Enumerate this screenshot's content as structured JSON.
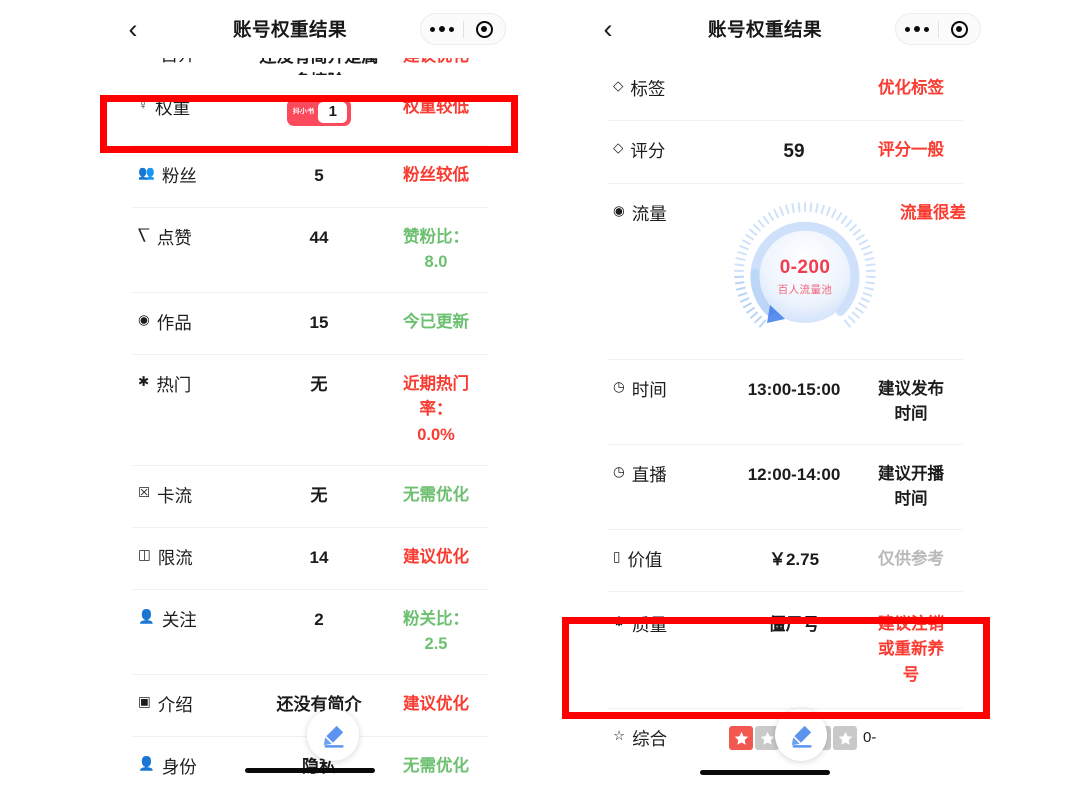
{
  "nav": {
    "back_icon": "chevron-left-icon",
    "title": "账号权重结果",
    "more_icon": "more-dots-icon",
    "target_icon": "target-circle-icon"
  },
  "left_panel": {
    "clipped_row": {
      "label": "一 自介",
      "value": "还没有简介是属多擦除",
      "status": "建议优化"
    },
    "rows": [
      {
        "icon": "location-pin-icon",
        "label": "权重",
        "value_type": "badge",
        "badge_text": "抖小书",
        "badge_number": "1",
        "status": "权重较低",
        "status_color": "red",
        "highlighted": true
      },
      {
        "icon": "people-icon",
        "label": "粉丝",
        "value": "5",
        "status": "粉丝较低",
        "status_color": "red"
      },
      {
        "icon": "thumb-icon",
        "label": "点赞",
        "value": "44",
        "status": "赞粉比：\n8.0",
        "status_color": "green"
      },
      {
        "icon": "circle-dot-icon",
        "label": "作品",
        "value": "15",
        "status": "今已更新",
        "status_color": "green"
      },
      {
        "icon": "star-small-icon",
        "label": "热门",
        "value": "无",
        "status": "近期热门\n率：\n0.0%",
        "status_color": "red"
      },
      {
        "icon": "card-slash-icon",
        "label": "卡流",
        "value": "无",
        "status": "无需优化",
        "status_color": "green"
      },
      {
        "icon": "doc-icon",
        "label": "限流",
        "value": "14",
        "status": "建议优化",
        "status_color": "red"
      },
      {
        "icon": "person-add-icon",
        "label": "关注",
        "value": "2",
        "status": "粉关比：\n2.5",
        "status_color": "green"
      },
      {
        "icon": "note-icon",
        "label": "介绍",
        "value": "还没有简介",
        "status": "建议优化",
        "status_color": "red"
      },
      {
        "icon": "person-icon",
        "label": "身份",
        "value": "隐私",
        "value_color": "pink",
        "status": "无需优化",
        "status_color": "green"
      }
    ],
    "fab_icon": "edit-pencil-icon",
    "home_indicator": true
  },
  "right_panel": {
    "rows": [
      {
        "icon": "tag-icon",
        "label": "标签",
        "value": "",
        "status": "优化标签",
        "status_color": "red"
      },
      {
        "icon": "tag-icon",
        "label": "评分",
        "value": "59",
        "value_color": "pink",
        "status": "评分一般",
        "status_color": "red"
      },
      {
        "icon": "circle-dot-icon",
        "label": "流量",
        "value_type": "gauge",
        "gauge_main": "0-200",
        "gauge_sub": "百人流量池",
        "status": "流量很差",
        "status_color": "red"
      },
      {
        "icon": "clock-icon",
        "label": "时间",
        "value": "13:00-15:00",
        "value_color": "blue",
        "status": "建议发布\n时间",
        "status_color": "dark"
      },
      {
        "icon": "clock-icon",
        "label": "直播",
        "value": "12:00-14:00",
        "value_color": "blue",
        "status": "建议开播\n时间",
        "status_color": "dark"
      },
      {
        "icon": "money-icon",
        "label": "价值",
        "value": "￥2.75",
        "value_color": "pink",
        "status": "仅供参考",
        "status_color": "gray"
      },
      {
        "icon": "atom-icon",
        "label": "质量",
        "value": "僵尸号",
        "value_color": "red",
        "status": "建议注销\n或重新养\n号",
        "status_color": "red",
        "highlighted": true
      },
      {
        "icon": "star-outline-icon",
        "label": "综合",
        "value_type": "stars",
        "stars_filled": 1,
        "stars_total": 5,
        "status": "0-",
        "status_color": "dark"
      }
    ],
    "fab_icon": "edit-pencil-icon",
    "home_indicator": true
  },
  "annotations": {
    "highlight_color": "#ff0000",
    "boxes": [
      {
        "target": "权重",
        "panel": "left"
      },
      {
        "target": "质量",
        "panel": "right"
      }
    ]
  },
  "colors": {
    "red": "#fa3b31",
    "green": "#6cc070",
    "blue": "#4a86f7",
    "pink": "#f2486a",
    "gray": "#b9b9b9",
    "badge": "#fa4a5c"
  }
}
